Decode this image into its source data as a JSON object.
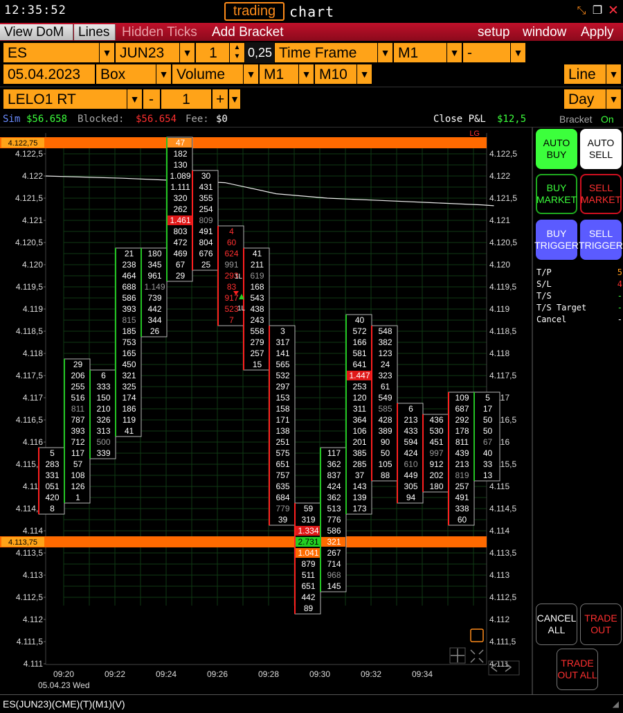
{
  "titlebar": {
    "clock": "12:35:52",
    "brand_word": "trading",
    "brand_rest": "chart"
  },
  "menubar": {
    "view_dom": "View DoM",
    "lines": "Lines",
    "hidden_ticks": "Hidden Ticks",
    "add_bracket": "Add Bracket",
    "setup": "setup",
    "window": "window",
    "apply": "Apply"
  },
  "toolbar1": {
    "symbol": "ES",
    "contract": "JUN23",
    "qty": "1",
    "tick": "0,25",
    "timeframe_label": "Time Frame",
    "tf_value": "M1",
    "tf_extra": "-"
  },
  "toolbar2": {
    "date": "05.04.2023",
    "box": "Box",
    "volume": "Volume",
    "m1": "M1",
    "m10": "M10",
    "line": "Line"
  },
  "toolbar3": {
    "account": "LELO1 RT",
    "minus": "-",
    "qty": "1",
    "plus": "+",
    "period": "Day"
  },
  "infobar": {
    "sim_label": "Sim",
    "sim_value": "$56.658",
    "blocked_label": "Blocked:",
    "blocked_value": "$56.654",
    "fee_label": "Fee:",
    "fee_value": "$0",
    "close_pl_label": "Close P&L",
    "close_pl_value": "$12,5",
    "bracket_label": "Bracket",
    "bracket_value": "On"
  },
  "side": {
    "auto_buy": "AUTO BUY",
    "auto_sell": "AUTO SELL",
    "buy_market": "BUY MARKET",
    "sell_market": "SELL MARKET",
    "buy_trigger": "BUY TRIGGER",
    "sell_trigger": "SELL TRIGGER",
    "stats": [
      {
        "label": "T/P",
        "value": "5",
        "color": "#ff9a1a"
      },
      {
        "label": "S/L",
        "value": "4",
        "color": "#ff3030"
      },
      {
        "label": "T/S",
        "value": "-",
        "color": "#3cff3c"
      },
      {
        "label": "T/S Target",
        "value": "-",
        "color": "#3cff3c"
      },
      {
        "label": "Cancel",
        "value": "-",
        "color": "#ffffff"
      }
    ],
    "cancel_all": "CANCEL ALL",
    "trade_out": "TRADE OUT",
    "trade_out_all": "TRADE OUT ALL"
  },
  "statusbar": {
    "text": "ES(JUN23)(CME)(T)(M1)(V)"
  },
  "colors": {
    "accent": "#ffa318",
    "level_line": "#ff6a00",
    "up": "#24c424",
    "down": "#ff2020"
  },
  "chart_data": {
    "type": "footprint",
    "y_ticks": [
      "4.122,5",
      "4.122",
      "4.121,5",
      "4.121",
      "4.120,5",
      "4.120",
      "4.119,5",
      "4.119",
      "4.118,5",
      "4.118",
      "4.117,5",
      "4.117",
      "4.116,5",
      "4.116",
      "4.115,5",
      "4.115",
      "4.114,5",
      "4.114",
      "4.113,5",
      "4.113",
      "4.112,5",
      "4.112",
      "4.111,5",
      "4.111"
    ],
    "x_ticks": [
      "09:20",
      "09:22",
      "09:24",
      "09:26",
      "09:28",
      "09:30",
      "09:32",
      "09:34"
    ],
    "date_label": "05.04.23 Wed",
    "levels": [
      {
        "price": 4122.75,
        "label": "4.122,75",
        "tag": "LG"
      },
      {
        "price": 4113.75,
        "label": "4.113,75"
      }
    ],
    "markers": [
      "1L",
      "1L"
    ],
    "vwap": [
      [
        0,
        4122.0
      ],
      [
        3,
        4121.95
      ],
      [
        5,
        4121.9
      ],
      [
        7,
        4121.85
      ],
      [
        9,
        4121.6
      ],
      [
        11,
        4121.5
      ],
      [
        13,
        4121.45
      ],
      [
        15,
        4121.4
      ],
      [
        17,
        4121.35
      ],
      [
        17.5,
        4121.33
      ]
    ],
    "candles": [
      {
        "i": 0,
        "dir": "down",
        "top": 4115.75,
        "cells": [
          [
            "5",
            ""
          ],
          [
            "283",
            ""
          ],
          [
            "331",
            ""
          ],
          [
            "051",
            ""
          ],
          [
            "420",
            ""
          ],
          [
            "8",
            ""
          ]
        ]
      },
      {
        "i": 1,
        "dir": "up",
        "top": 4117.75,
        "cells": [
          [
            "29",
            ""
          ],
          [
            "206",
            ""
          ],
          [
            "255",
            ""
          ],
          [
            "516",
            ""
          ],
          [
            "811",
            "g"
          ],
          [
            "787",
            ""
          ],
          [
            "393",
            ""
          ],
          [
            "712",
            ""
          ],
          [
            "117",
            ""
          ],
          [
            "57",
            ""
          ],
          [
            "108",
            ""
          ],
          [
            "126",
            ""
          ],
          [
            "1",
            ""
          ]
        ]
      },
      {
        "i": 2,
        "dir": "up",
        "top": 4117.5,
        "cells": [
          [
            "6",
            ""
          ],
          [
            "333",
            ""
          ],
          [
            "150",
            ""
          ],
          [
            "210",
            ""
          ],
          [
            "326",
            ""
          ],
          [
            "313",
            ""
          ],
          [
            "500",
            "g"
          ],
          [
            "339",
            ""
          ]
        ]
      },
      {
        "i": 3,
        "dir": "up",
        "top": 4120.25,
        "cells": [
          [
            "21",
            ""
          ],
          [
            "238",
            ""
          ],
          [
            "464",
            ""
          ],
          [
            "688",
            ""
          ],
          [
            "586",
            ""
          ],
          [
            "393",
            ""
          ],
          [
            "815",
            "g"
          ],
          [
            "185",
            ""
          ],
          [
            "753",
            ""
          ],
          [
            "165",
            ""
          ],
          [
            "450",
            ""
          ],
          [
            "321",
            ""
          ],
          [
            "325",
            ""
          ],
          [
            "174",
            ""
          ],
          [
            "186",
            ""
          ],
          [
            "119",
            ""
          ],
          [
            "41",
            ""
          ]
        ]
      },
      {
        "i": 4,
        "dir": "up",
        "top": 4120.25,
        "cells": [
          [
            "180",
            ""
          ],
          [
            "345",
            ""
          ],
          [
            "961",
            ""
          ],
          [
            "1.149",
            "g"
          ],
          [
            "739",
            ""
          ],
          [
            "442",
            ""
          ],
          [
            "344",
            ""
          ],
          [
            "26",
            ""
          ]
        ]
      },
      {
        "i": 5,
        "dir": "up",
        "top": 4122.75,
        "cells": [
          [
            "47",
            "o"
          ],
          [
            "182",
            ""
          ],
          [
            "130",
            ""
          ],
          [
            "1.089",
            ""
          ],
          [
            "1.111",
            ""
          ],
          [
            "320",
            ""
          ],
          [
            "262",
            ""
          ],
          [
            "1.461",
            "r"
          ],
          [
            "803",
            ""
          ],
          [
            "472",
            ""
          ],
          [
            "469",
            ""
          ],
          [
            "67",
            ""
          ],
          [
            "29",
            ""
          ]
        ]
      },
      {
        "i": 6,
        "dir": "down",
        "top": 4122.0,
        "cells": [
          [
            "30",
            ""
          ],
          [
            "431",
            ""
          ],
          [
            "355",
            ""
          ],
          [
            "254",
            ""
          ],
          [
            "809",
            "g"
          ],
          [
            "491",
            ""
          ],
          [
            "804",
            ""
          ],
          [
            "676",
            ""
          ],
          [
            "25",
            ""
          ]
        ]
      },
      {
        "i": 7,
        "dir": "down",
        "top": 4120.75,
        "cells": [
          [
            "4",
            "rt"
          ],
          [
            "60",
            "rt"
          ],
          [
            "624",
            "rt"
          ],
          [
            "991",
            "g"
          ],
          [
            "293",
            "rt"
          ],
          [
            "83",
            "rt"
          ],
          [
            "917",
            "rt"
          ],
          [
            "523",
            "rt"
          ],
          [
            "7",
            "rt"
          ]
        ]
      },
      {
        "i": 8,
        "dir": "down",
        "top": 4120.25,
        "cells": [
          [
            "41",
            ""
          ],
          [
            "211",
            ""
          ],
          [
            "619",
            "g"
          ],
          [
            "168",
            ""
          ],
          [
            "543",
            ""
          ],
          [
            "438",
            ""
          ],
          [
            "243",
            ""
          ],
          [
            "558",
            ""
          ],
          [
            "279",
            ""
          ],
          [
            "257",
            ""
          ],
          [
            "15",
            ""
          ]
        ]
      },
      {
        "i": 9,
        "dir": "down",
        "top": 4118.5,
        "cells": [
          [
            "3",
            ""
          ],
          [
            "317",
            ""
          ],
          [
            "141",
            ""
          ],
          [
            "565",
            ""
          ],
          [
            "532",
            ""
          ],
          [
            "297",
            ""
          ],
          [
            "153",
            ""
          ],
          [
            "158",
            ""
          ],
          [
            "171",
            ""
          ],
          [
            "138",
            ""
          ],
          [
            "251",
            ""
          ],
          [
            "575",
            ""
          ],
          [
            "651",
            ""
          ],
          [
            "757",
            ""
          ],
          [
            "635",
            ""
          ],
          [
            "684",
            ""
          ],
          [
            "779",
            "g"
          ],
          [
            "39",
            ""
          ]
        ]
      },
      {
        "i": 10,
        "dir": "down",
        "top": 4114.5,
        "cells": [
          [
            "59",
            ""
          ],
          [
            "319",
            ""
          ],
          [
            "1.334",
            "r"
          ],
          [
            "2.731",
            "gr"
          ],
          [
            "1.041",
            "o2"
          ],
          [
            "879",
            ""
          ],
          [
            "511",
            ""
          ],
          [
            "651",
            ""
          ],
          [
            "442",
            ""
          ],
          [
            "89",
            ""
          ]
        ]
      },
      {
        "i": 11,
        "dir": "up",
        "top": 4115.75,
        "cells": [
          [
            "117",
            ""
          ],
          [
            "362",
            ""
          ],
          [
            "837",
            ""
          ],
          [
            "424",
            ""
          ],
          [
            "362",
            ""
          ],
          [
            "513",
            ""
          ],
          [
            "776",
            ""
          ],
          [
            "586",
            ""
          ],
          [
            "321",
            "o2"
          ],
          [
            "267",
            ""
          ],
          [
            "714",
            ""
          ],
          [
            "968",
            "g"
          ],
          [
            "145",
            ""
          ]
        ]
      },
      {
        "i": 12,
        "dir": "up",
        "top": 4118.75,
        "cells": [
          [
            "40",
            ""
          ],
          [
            "572",
            ""
          ],
          [
            "166",
            ""
          ],
          [
            "581",
            ""
          ],
          [
            "641",
            ""
          ],
          [
            "1.447",
            "r"
          ],
          [
            "253",
            ""
          ],
          [
            "120",
            ""
          ],
          [
            "311",
            ""
          ],
          [
            "364",
            ""
          ],
          [
            "106",
            ""
          ],
          [
            "201",
            ""
          ],
          [
            "385",
            ""
          ],
          [
            "285",
            ""
          ],
          [
            "37",
            ""
          ],
          [
            "143",
            ""
          ],
          [
            "139",
            ""
          ],
          [
            "173",
            ""
          ]
        ]
      },
      {
        "i": 13,
        "dir": "down",
        "top": 4118.5,
        "cells": [
          [
            "548",
            ""
          ],
          [
            "382",
            ""
          ],
          [
            "123",
            ""
          ],
          [
            "24",
            ""
          ],
          [
            "323",
            ""
          ],
          [
            "61",
            ""
          ],
          [
            "549",
            ""
          ],
          [
            "585",
            "g"
          ],
          [
            "428",
            ""
          ],
          [
            "389",
            ""
          ],
          [
            "90",
            ""
          ],
          [
            "50",
            ""
          ],
          [
            "105",
            ""
          ],
          [
            "88",
            ""
          ]
        ]
      },
      {
        "i": 14,
        "dir": "down",
        "top": 4116.75,
        "cells": [
          [
            "6",
            ""
          ],
          [
            "213",
            ""
          ],
          [
            "433",
            ""
          ],
          [
            "594",
            ""
          ],
          [
            "424",
            ""
          ],
          [
            "610",
            "g"
          ],
          [
            "449",
            ""
          ],
          [
            "305",
            ""
          ],
          [
            "94",
            ""
          ]
        ]
      },
      {
        "i": 15,
        "dir": "down",
        "top": 4116.5,
        "cells": [
          [
            "436",
            ""
          ],
          [
            "530",
            ""
          ],
          [
            "451",
            ""
          ],
          [
            "997",
            "g"
          ],
          [
            "912",
            ""
          ],
          [
            "202",
            ""
          ],
          [
            "180",
            ""
          ]
        ]
      },
      {
        "i": 16,
        "dir": "down",
        "top": 4117.0,
        "cells": [
          [
            "109",
            ""
          ],
          [
            "687",
            ""
          ],
          [
            "292",
            ""
          ],
          [
            "178",
            ""
          ],
          [
            "811",
            ""
          ],
          [
            "439",
            ""
          ],
          [
            "213",
            ""
          ],
          [
            "819",
            "g"
          ],
          [
            "257",
            ""
          ],
          [
            "491",
            ""
          ],
          [
            "338",
            ""
          ],
          [
            "60",
            ""
          ]
        ]
      },
      {
        "i": 17,
        "dir": "up",
        "top": 4117.0,
        "cells": [
          [
            "5",
            ""
          ],
          [
            "17",
            ""
          ],
          [
            "50",
            ""
          ],
          [
            "50",
            ""
          ],
          [
            "67",
            "g"
          ],
          [
            "40",
            ""
          ],
          [
            "33",
            ""
          ],
          [
            "13",
            ""
          ]
        ]
      }
    ]
  }
}
